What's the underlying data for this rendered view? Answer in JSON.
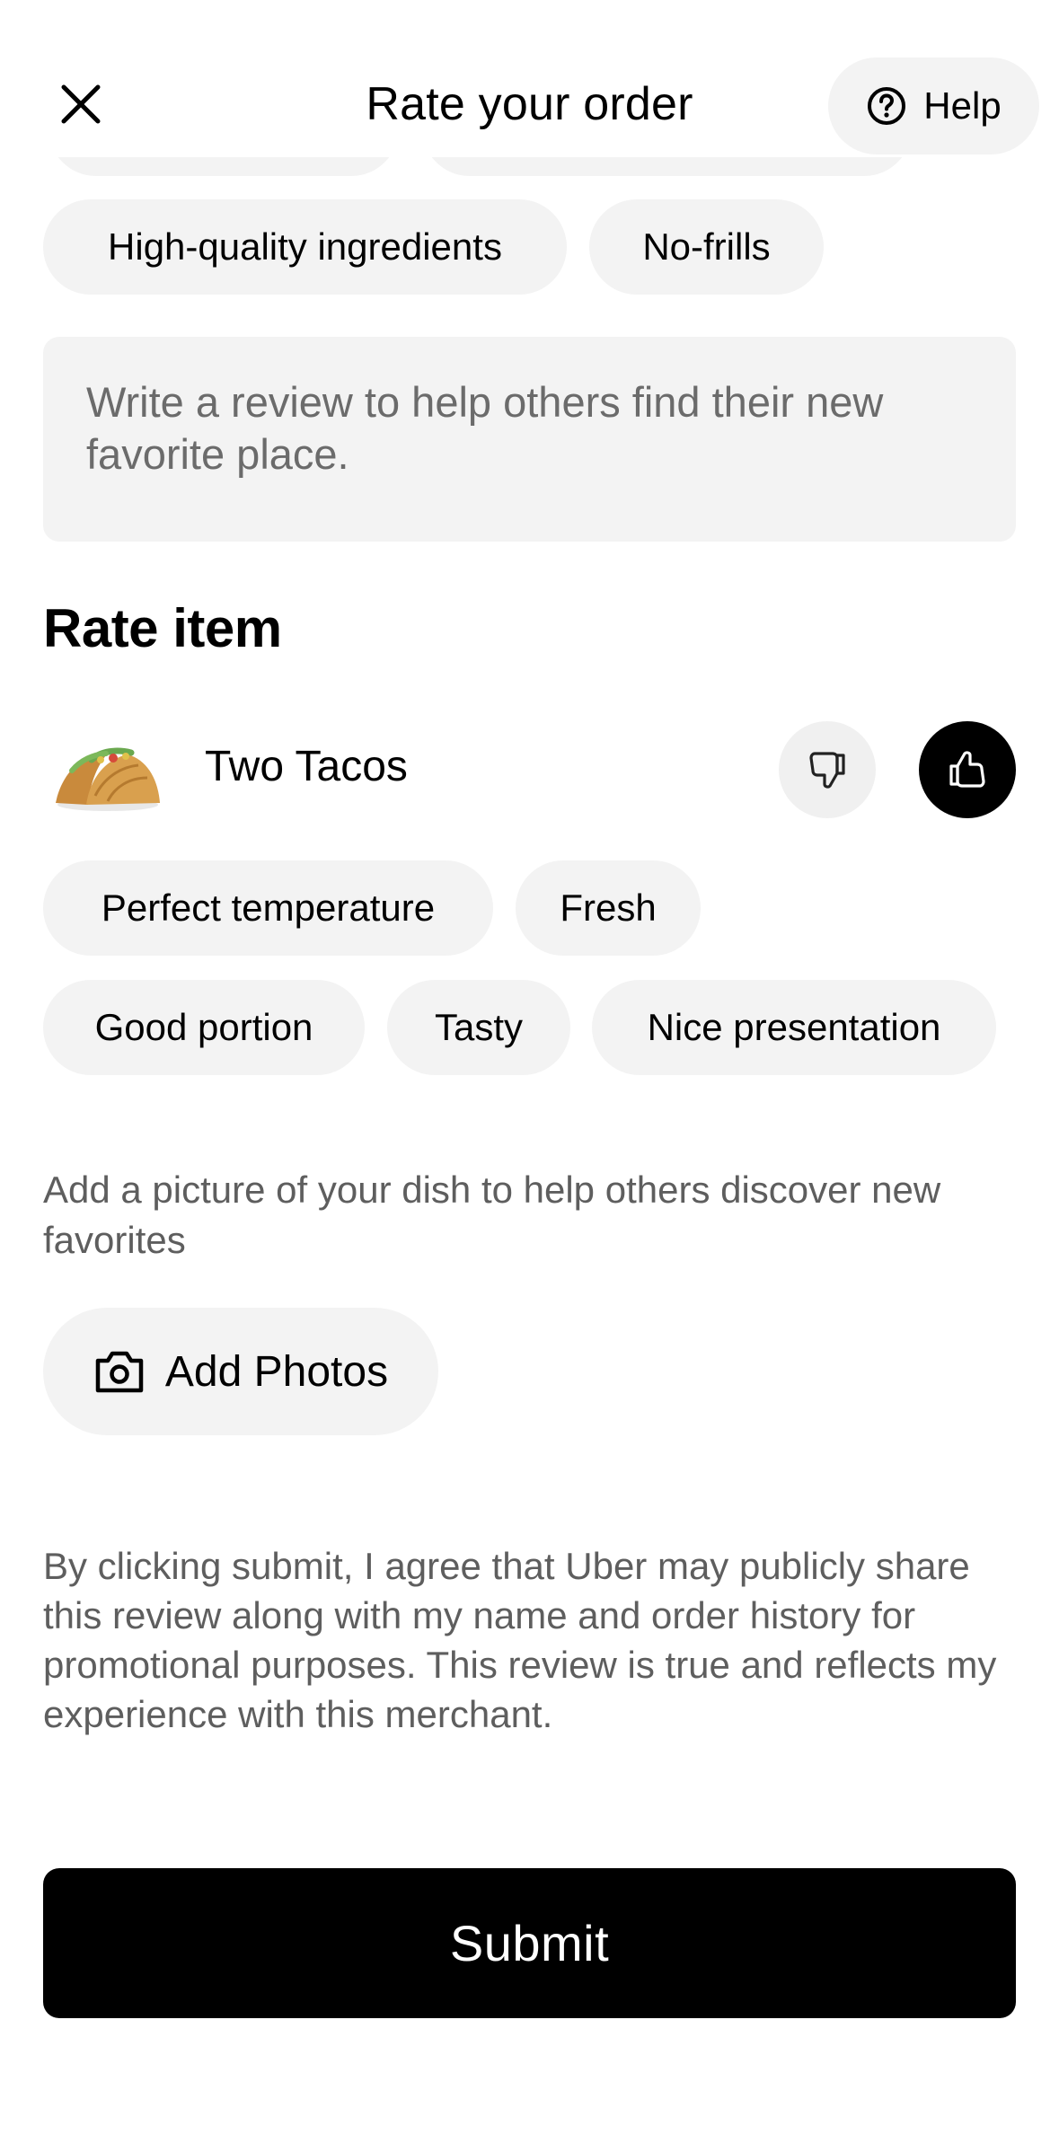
{
  "header": {
    "title": "Rate your order",
    "help_label": "Help",
    "close_icon": "close-icon",
    "help_icon": "help-circle-icon"
  },
  "restaurant_tags": [
    {
      "label": "High-quality ingredients"
    },
    {
      "label": "No-frills"
    }
  ],
  "review": {
    "placeholder": "Write a review to help others find their new favorite place."
  },
  "rate_item": {
    "section_title": "Rate item",
    "item_name": "Two Tacos",
    "thumbs_down_icon": "thumbs-down-icon",
    "thumbs_up_icon": "thumbs-up-icon",
    "thumbs_up_selected": true,
    "tags": [
      {
        "label": "Perfect temperature"
      },
      {
        "label": "Fresh"
      },
      {
        "label": "Good portion"
      },
      {
        "label": "Tasty"
      },
      {
        "label": "Nice presentation"
      }
    ]
  },
  "photos": {
    "hint": "Add a picture of your dish to help others discover new favorites",
    "button_label": "Add Photos",
    "button_icon": "camera-icon"
  },
  "legal_text": "By clicking submit, I agree that Uber may publicly share this review along with my name and order history for promotional purposes. This review is true and reflects my experience with this merchant.",
  "submit_label": "Submit",
  "colors": {
    "chip_bg": "#f3f3f3",
    "primary": "#000000",
    "secondary_text": "#5e5e5e",
    "placeholder_text": "#6b6b6b"
  }
}
